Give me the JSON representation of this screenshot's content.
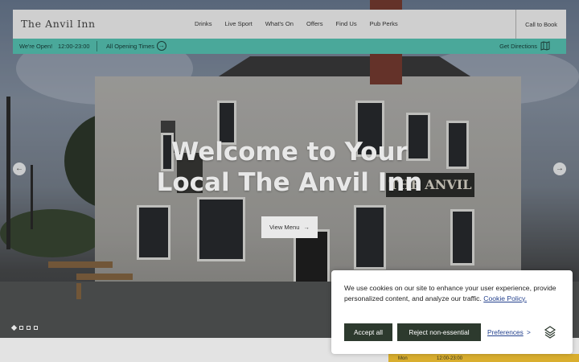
{
  "brand": {
    "name": "The Anvil Inn"
  },
  "nav": {
    "items": [
      "Drinks",
      "Live Sport",
      "What's On",
      "Offers",
      "Find Us",
      "Pub Perks"
    ],
    "call_label": "Call to Book"
  },
  "infobar": {
    "status": "We're Open!",
    "hours": "12:00-23:00",
    "all_times": "All Opening Times",
    "directions": "Get Directions"
  },
  "hero": {
    "title": "Welcome to Your Local The Anvil Inn",
    "cta_label": "View Menu",
    "sign_text": "THE ANVIL",
    "slide_count": 4,
    "active_slide": 1
  },
  "opening_hours_preview": {
    "day": "Mon",
    "hours": "12:00-23:00"
  },
  "cookie": {
    "message": "We use cookies on our site to enhance your user experience, provide personalized content, and analyze our traffic.",
    "policy_link": "Cookie Policy.",
    "accept_label": "Accept all",
    "reject_label": "Reject non-essential",
    "preferences_label": "Preferences",
    "preferences_arrow": ">"
  },
  "colors": {
    "header_bg": "#cfcfcf",
    "accent_teal": "#4aa89a",
    "cookie_button": "#2d3a2e",
    "link_blue": "#25428e",
    "hours_gold": "#d9ae2e"
  }
}
